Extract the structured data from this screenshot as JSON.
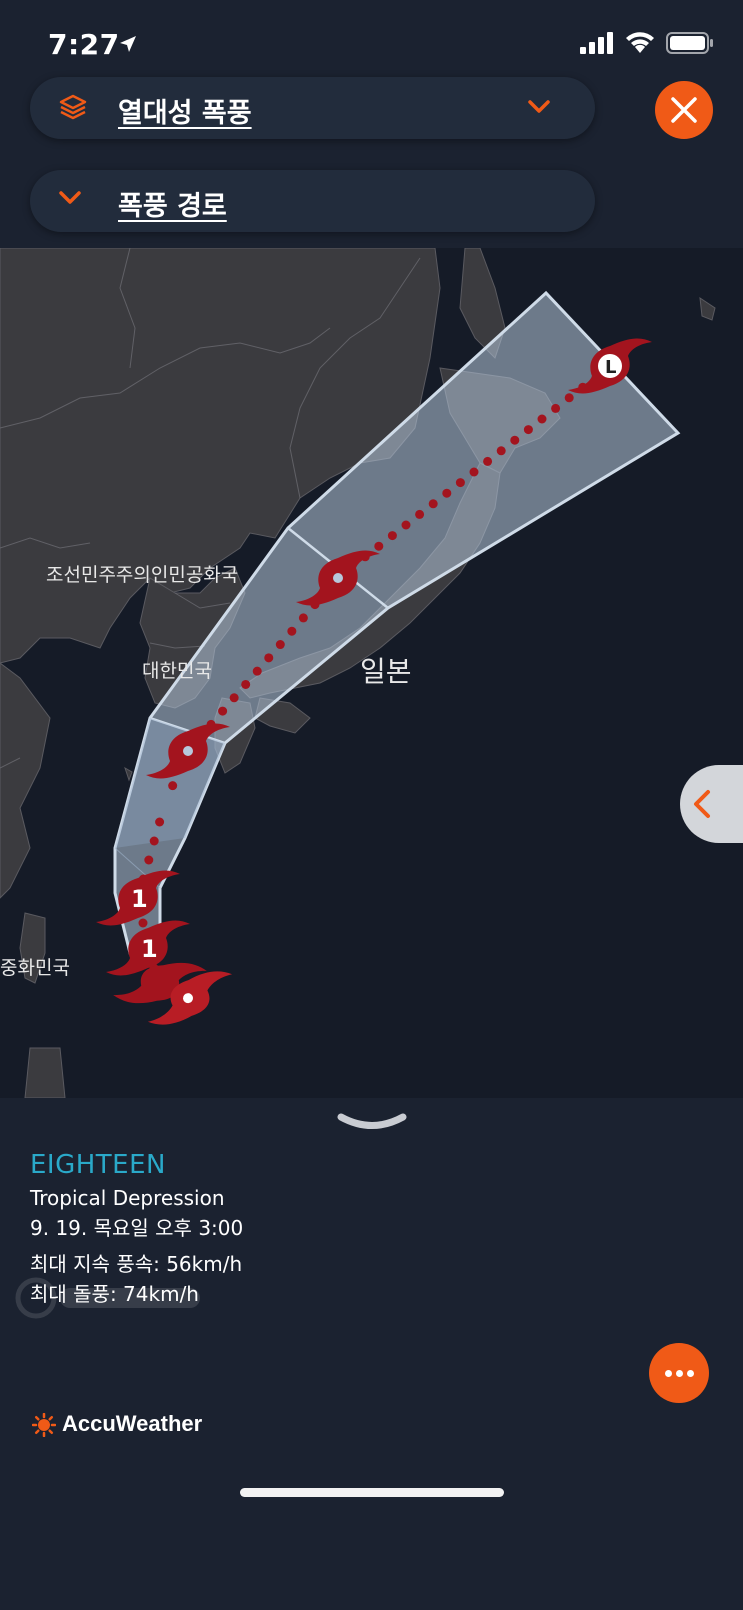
{
  "status_bar": {
    "time": "7:27"
  },
  "header": {
    "layer_label": "열대성 폭풍",
    "track_label": "폭풍 경로"
  },
  "icons": {
    "layers": "layers-icon",
    "close": "close-icon",
    "chevron": "chevron-down-icon",
    "more": "more-icon"
  },
  "map": {
    "labels": {
      "north_korea": "조선민주주의인민공화국",
      "south_korea": "대한민국",
      "japan": "일본",
      "taiwan": "중화민국"
    },
    "storm_markers": [
      {
        "category": "L"
      },
      {
        "category": ""
      },
      {
        "category": ""
      },
      {
        "category": "1"
      },
      {
        "category": "1"
      }
    ]
  },
  "panel": {
    "storm_name": "EIGHTEEN",
    "storm_type": "Tropical Depression",
    "datetime": "9. 19. 목요일 오후 3:00",
    "max_sustained_wind": "최대 지속 풍속: 56km/h",
    "max_gust": "최대 돌풍: 74km/h",
    "brand": "AccuWeather"
  },
  "colors": {
    "accent": "#f05a17",
    "storm_red": "#a3141e",
    "cone_fill": "#b7c8dc",
    "storm_name": "#2aa9c9"
  }
}
